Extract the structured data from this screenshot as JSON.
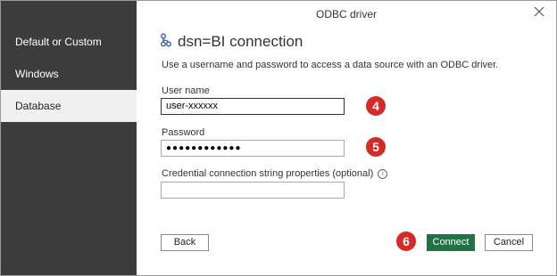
{
  "window": {
    "title": "ODBC driver"
  },
  "sidebar": {
    "items": [
      {
        "label": "Default or Custom",
        "active": false
      },
      {
        "label": "Windows",
        "active": false
      },
      {
        "label": "Database",
        "active": true
      }
    ]
  },
  "main": {
    "heading": "dsn=BI connection",
    "heading_icon": "odbc-connection-icon",
    "description": "Use a username and password to access a data source with an ODBC driver.",
    "username": {
      "label": "User name",
      "value": "user-xxxxxx"
    },
    "password": {
      "label": "Password",
      "value": "●●●●●●●●●●●●"
    },
    "credential": {
      "label": "Credential connection string properties (optional)",
      "info_icon": "i",
      "value": ""
    }
  },
  "callouts": {
    "username": "4",
    "password": "5",
    "connect": "6"
  },
  "buttons": {
    "back": "Back",
    "connect": "Connect",
    "cancel": "Cancel"
  },
  "colors": {
    "sidebar": "#3c3c3c",
    "primary": "#217346",
    "callout": "#d42a2a"
  }
}
